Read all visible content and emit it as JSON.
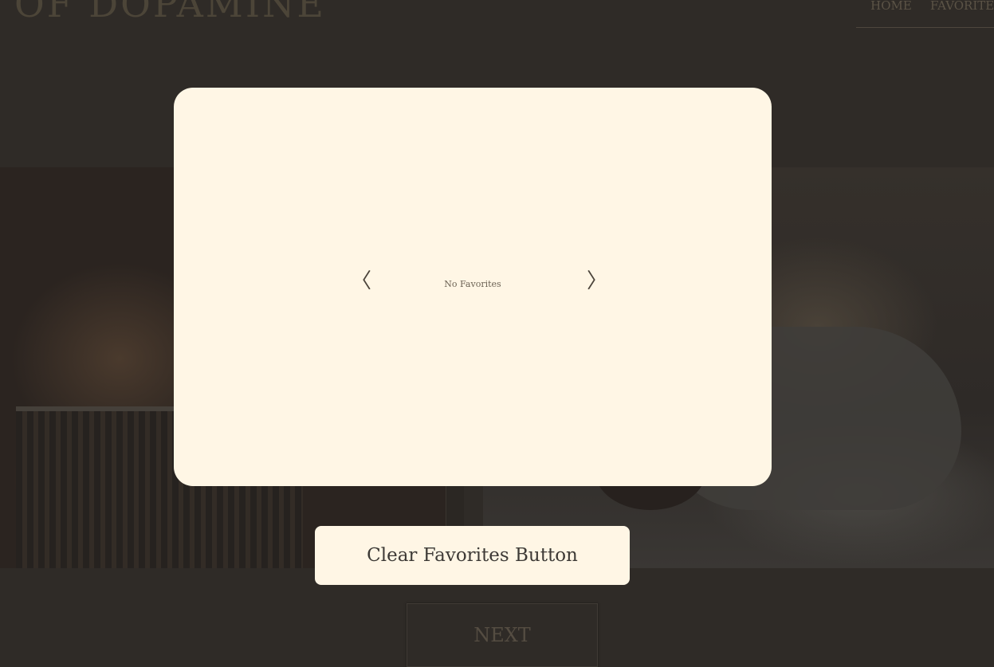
{
  "header": {
    "logo_text": "OF DOPAMINE",
    "nav": [
      {
        "label": "HOME"
      },
      {
        "label": "FAVORITES"
      }
    ]
  },
  "modal": {
    "prev_glyph": "〈",
    "next_glyph": "〉",
    "empty_message": "No Favorites"
  },
  "clear_button": {
    "label": "Clear Favorites Button"
  },
  "next_button": {
    "label": "NEXT"
  },
  "colors": {
    "modal_background": "#fff6e5",
    "page_background": "#2f2b27"
  }
}
